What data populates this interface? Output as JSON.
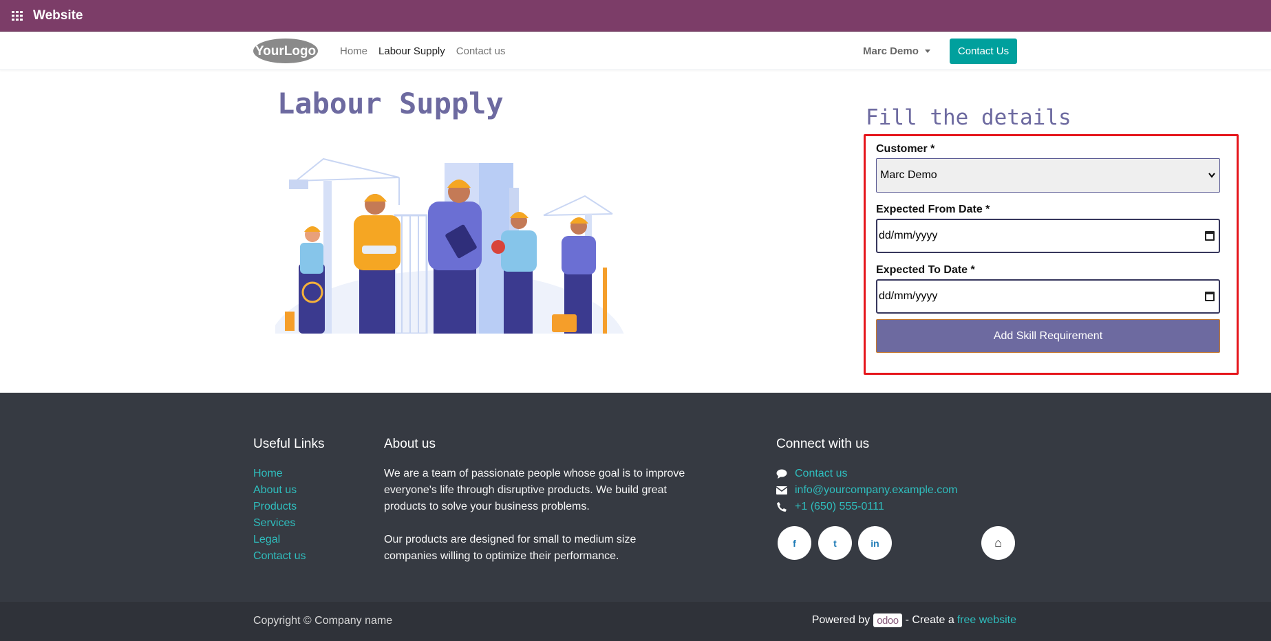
{
  "appbar": {
    "title": "Website",
    "icon": "apps-grid-icon"
  },
  "navbar": {
    "logo_text": "YourLogo",
    "links": [
      {
        "label": "Home",
        "active": false
      },
      {
        "label": "Labour Supply",
        "active": true
      },
      {
        "label": "Contact us",
        "active": false
      }
    ],
    "user": "Marc Demo",
    "contact_button": "Contact Us"
  },
  "main": {
    "title": "Labour Supply",
    "form": {
      "heading": "Fill the details",
      "customer_label": "Customer *",
      "customer_value": "Marc Demo",
      "from_label": "Expected From Date *",
      "from_placeholder": "dd/mm/yyyy",
      "to_label": "Expected To Date *",
      "to_placeholder": "dd/mm/yyyy",
      "submit_label": "Add Skill Requirement"
    }
  },
  "footer": {
    "useful_links_title": "Useful Links",
    "useful_links": [
      "Home",
      "About us",
      "Products",
      "Services",
      "Legal",
      "Contact us"
    ],
    "about_title": "About us",
    "about_lines": [
      "We are a team of passionate people whose goal is to improve",
      "everyone's life through disruptive products. We build great",
      "products to solve your business problems.",
      "",
      "Our products are designed for small to medium size",
      "companies willing to optimize their performance."
    ],
    "connect_title": "Connect with us",
    "connect": [
      {
        "icon": "chat-icon",
        "label": "Contact us"
      },
      {
        "icon": "envelope-icon",
        "label": "info@yourcompany.example.com"
      },
      {
        "icon": "phone-icon",
        "label": "+1 (650) 555-0111"
      }
    ],
    "social": [
      {
        "icon": "facebook-icon",
        "glyph": "f"
      },
      {
        "icon": "twitter-icon",
        "glyph": "t"
      },
      {
        "icon": "linkedin-icon",
        "glyph": "in"
      },
      {
        "icon": "home-icon",
        "glyph": "⌂"
      }
    ],
    "copyright": "Copyright © Company name",
    "powered_by": "Powered by",
    "odoo": "odoo",
    "create_a": "- Create a",
    "free_website": "free website"
  },
  "colors": {
    "appbar": "#7c3d68",
    "accent_teal": "#00a09d",
    "title_purple": "#6d6aa0",
    "highlight_red": "#e5161c",
    "footer_bg": "#363a42"
  }
}
